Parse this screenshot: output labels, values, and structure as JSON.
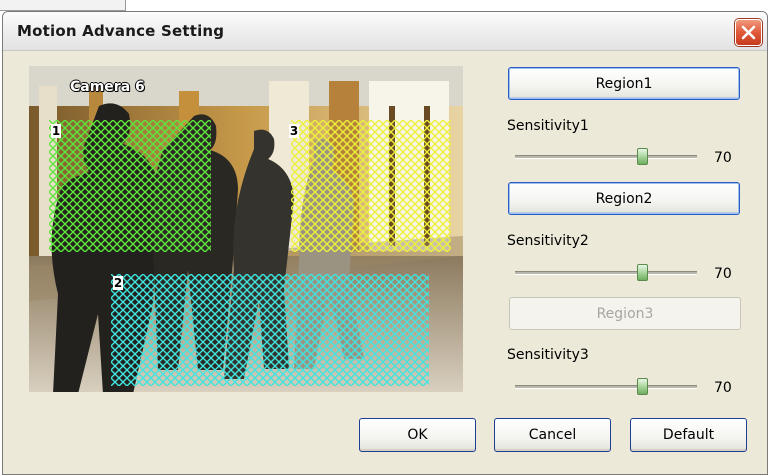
{
  "window": {
    "title": "Motion Advance Setting"
  },
  "video": {
    "camera_label": "Camera 6",
    "regions": [
      {
        "number": "1",
        "color": "#5ee63c"
      },
      {
        "number": "2",
        "color": "#3fe6e0"
      },
      {
        "number": "3",
        "color": "#ecf23a"
      }
    ]
  },
  "controls": {
    "region1_label": "Region1",
    "region2_label": "Region2",
    "region3_label": "Region3",
    "sensitivity1_label": "Sensitivity1",
    "sensitivity2_label": "Sensitivity2",
    "sensitivity3_label": "Sensitivity3",
    "sensitivity1_value": "70",
    "sensitivity2_value": "70",
    "sensitivity3_value": "70",
    "slider_max": 100
  },
  "footer": {
    "ok_label": "OK",
    "cancel_label": "Cancel",
    "default_label": "Default"
  },
  "icons": {
    "close": "close-icon"
  },
  "colors": {
    "close_button": "#e0593a",
    "slider_thumb": "#a9d69d",
    "button_border": "#1c3f94"
  }
}
